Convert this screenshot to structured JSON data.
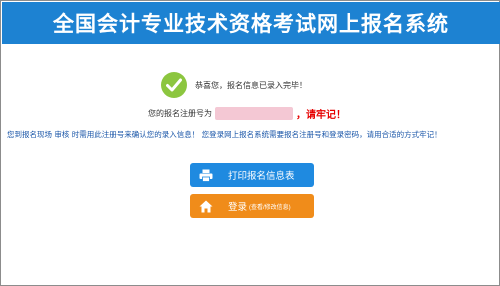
{
  "header": {
    "title": "全国会计专业技术资格考试网上报名系统"
  },
  "success": {
    "icon": "check-circle-icon",
    "message": "恭喜您，报名信息已录入完毕！"
  },
  "registration": {
    "label": "您的报名注册号为",
    "remember": "，请牢记！"
  },
  "notice": "您到报名现场 审核 时需用此注册号来确认您的录入信息！ 您登录网上报名系统需要报名注册号和登录密码，请用合适的方式牢记！",
  "buttons": {
    "print": {
      "label": "打印报名信息表",
      "icon": "printer-icon"
    },
    "login": {
      "label": "登录",
      "sub": "(查看/修改信息)",
      "icon": "home-icon"
    }
  },
  "colors": {
    "header_bg": "#1d82d2",
    "success_green": "#8cc63f",
    "alert_red": "#e60000",
    "notice_blue": "#1a56a8",
    "print_button": "#1f8ae0",
    "login_button": "#f08c1a"
  }
}
